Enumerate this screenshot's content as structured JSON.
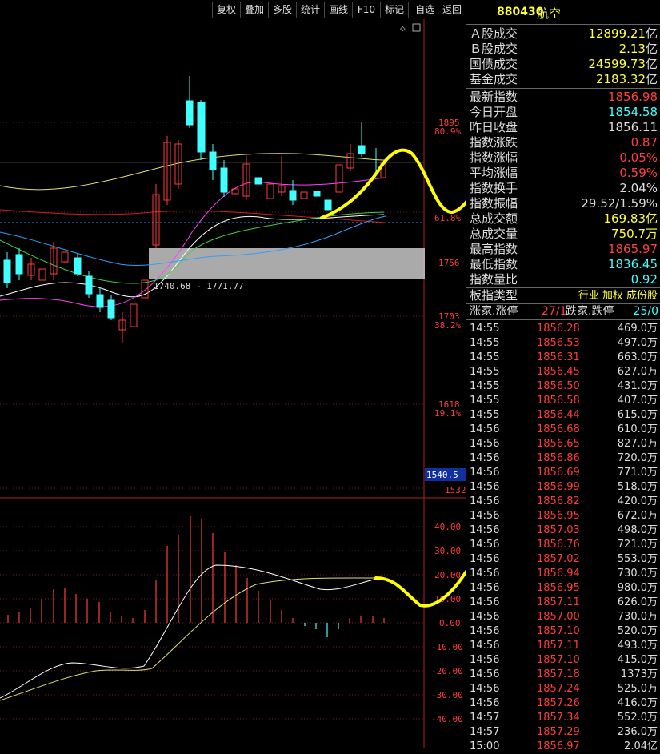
{
  "toolbar": {
    "buttons": [
      "复权",
      "叠加",
      "多股",
      "统计",
      "画线",
      "F10",
      "标记",
      "-自选",
      "返回"
    ]
  },
  "chart": {
    "price_labels": [
      {
        "value": "1895",
        "pct": "80.9%"
      },
      {
        "value": "1841",
        "pct": "61.8%"
      },
      {
        "value": "1756",
        "pct": ""
      },
      {
        "value": "1703",
        "pct": "38.2%"
      },
      {
        "value": "1618",
        "pct": "19.1%"
      },
      {
        "value": "1540.5",
        "pct": ""
      },
      {
        "value": "1532",
        "pct": ""
      }
    ],
    "zone_label": "1740.68 - 1771.77",
    "macd_labels": [
      "40.00",
      "30.00",
      "20.00",
      "10.00",
      "0.00",
      "-10.00",
      "-20.00",
      "-30.00",
      "-40.00"
    ],
    "colors": {
      "up": "#ff3c3c",
      "down": "#40ffff",
      "annotation": "#ffff00",
      "bg": "#000000"
    }
  },
  "panel": {
    "code": "880430",
    "name": "航空",
    "volume_rows": [
      {
        "label": "Ａ股成交",
        "value": "12899.21",
        "unit": "亿"
      },
      {
        "label": "Ｂ股成交",
        "value": "2.13",
        "unit": "亿"
      },
      {
        "label": "国债成交",
        "value": "24599.73",
        "unit": "亿"
      },
      {
        "label": "基金成交",
        "value": "2183.32",
        "unit": "亿"
      }
    ],
    "stat_rows": [
      {
        "label": "最新指数",
        "value": "1856.98",
        "color": "red"
      },
      {
        "label": "今日开盘",
        "value": "1854.58",
        "color": "cyan"
      },
      {
        "label": "昨日收盘",
        "value": "1856.11",
        "color": "white"
      },
      {
        "label": "指数涨跌",
        "value": "0.87",
        "color": "red"
      },
      {
        "label": "指数涨幅",
        "value": "0.05%",
        "color": "red"
      },
      {
        "label": "平均涨幅",
        "value": "0.59%",
        "color": "red"
      },
      {
        "label": "指数换手",
        "value": "2.04%",
        "color": "white"
      },
      {
        "label": "指数振幅",
        "value": "29.52/1.59%",
        "color": "white"
      },
      {
        "label": "总成交额",
        "value": "169.83亿",
        "color": "yellow"
      },
      {
        "label": "总成交量",
        "value": "750.7万",
        "color": "yellow"
      },
      {
        "label": "最高指数",
        "value": "1865.97",
        "color": "red"
      },
      {
        "label": "最低指数",
        "value": "1836.45",
        "color": "cyan"
      },
      {
        "label": "指数量比",
        "value": "0.92",
        "color": "cyan"
      }
    ],
    "type_label": "板指类型",
    "type_value": "行业 加权 成份股",
    "updown": {
      "up_label": "涨家.涨停",
      "up_value": "27/1",
      "down_label": "跌家.跌停",
      "down_value": "25/0"
    },
    "ticks": [
      {
        "time": "14:55",
        "price": "1856.28",
        "vol": "469.0万"
      },
      {
        "time": "14:55",
        "price": "1856.53",
        "vol": "497.0万"
      },
      {
        "time": "14:55",
        "price": "1856.31",
        "vol": "663.0万"
      },
      {
        "time": "14:55",
        "price": "1856.45",
        "vol": "627.0万"
      },
      {
        "time": "14:55",
        "price": "1856.50",
        "vol": "431.0万"
      },
      {
        "time": "14:55",
        "price": "1856.58",
        "vol": "407.0万"
      },
      {
        "time": "14:55",
        "price": "1856.44",
        "vol": "615.0万"
      },
      {
        "time": "14:56",
        "price": "1856.68",
        "vol": "610.0万"
      },
      {
        "time": "14:56",
        "price": "1856.65",
        "vol": "827.0万"
      },
      {
        "time": "14:56",
        "price": "1856.86",
        "vol": "720.0万"
      },
      {
        "time": "14:56",
        "price": "1856.69",
        "vol": "771.0万"
      },
      {
        "time": "14:56",
        "price": "1856.99",
        "vol": "518.0万"
      },
      {
        "time": "14:56",
        "price": "1856.82",
        "vol": "420.0万"
      },
      {
        "time": "14:56",
        "price": "1856.95",
        "vol": "672.0万"
      },
      {
        "time": "14:56",
        "price": "1857.03",
        "vol": "498.0万"
      },
      {
        "time": "14:56",
        "price": "1856.76",
        "vol": "721.0万"
      },
      {
        "time": "14:56",
        "price": "1857.02",
        "vol": "553.0万"
      },
      {
        "time": "14:56",
        "price": "1856.94",
        "vol": "730.0万"
      },
      {
        "time": "14:56",
        "price": "1856.95",
        "vol": "980.0万"
      },
      {
        "time": "14:56",
        "price": "1857.11",
        "vol": "626.0万"
      },
      {
        "time": "14:56",
        "price": "1857.00",
        "vol": "730.0万"
      },
      {
        "time": "14:56",
        "price": "1857.10",
        "vol": "520.0万"
      },
      {
        "time": "14:56",
        "price": "1857.11",
        "vol": "493.0万"
      },
      {
        "time": "14:56",
        "price": "1857.10",
        "vol": "415.0万"
      },
      {
        "time": "14:56",
        "price": "1857.18",
        "vol": "1373万"
      },
      {
        "time": "14:56",
        "price": "1857.24",
        "vol": "525.0万"
      },
      {
        "time": "14:56",
        "price": "1857.26",
        "vol": "416.0万"
      },
      {
        "time": "14:57",
        "price": "1857.34",
        "vol": "552.0万"
      },
      {
        "time": "14:57",
        "price": "1857.29",
        "vol": "236.0万"
      },
      {
        "time": "15:00",
        "price": "1856.97",
        "vol": "2.04亿"
      }
    ]
  }
}
